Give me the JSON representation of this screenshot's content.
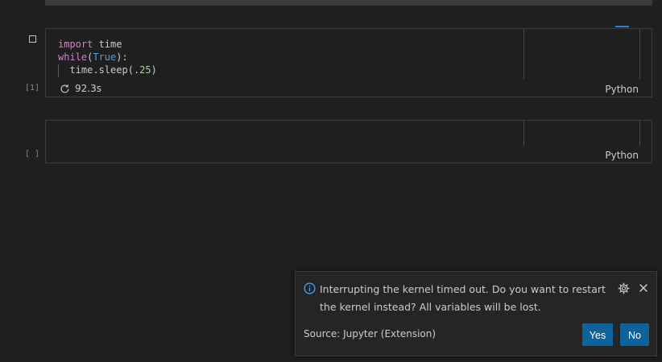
{
  "cells": [
    {
      "exec_count": "[1]",
      "code": {
        "line1_kw": "import",
        "line1_rest": " time",
        "line2_kw": "while",
        "line2_open": "(",
        "line2_builtin": "True",
        "line2_close": "):",
        "line3_func": "time.sleep(",
        "line3_num": ".25",
        "line3_close": ")"
      },
      "status_time": "92.3s",
      "language": "Python"
    },
    {
      "exec_count": "[ ]",
      "language": "Python"
    }
  ],
  "notification": {
    "message": "Interrupting the kernel timed out. Do you want to restart the kernel instead? All variables will be lost.",
    "source": "Source: Jupyter (Extension)",
    "yes_label": "Yes",
    "no_label": "No"
  },
  "colors": {
    "background": "#1f1f1f",
    "button": "#0e639c",
    "keyword": "#c586c0",
    "builtin": "#569cd6"
  }
}
